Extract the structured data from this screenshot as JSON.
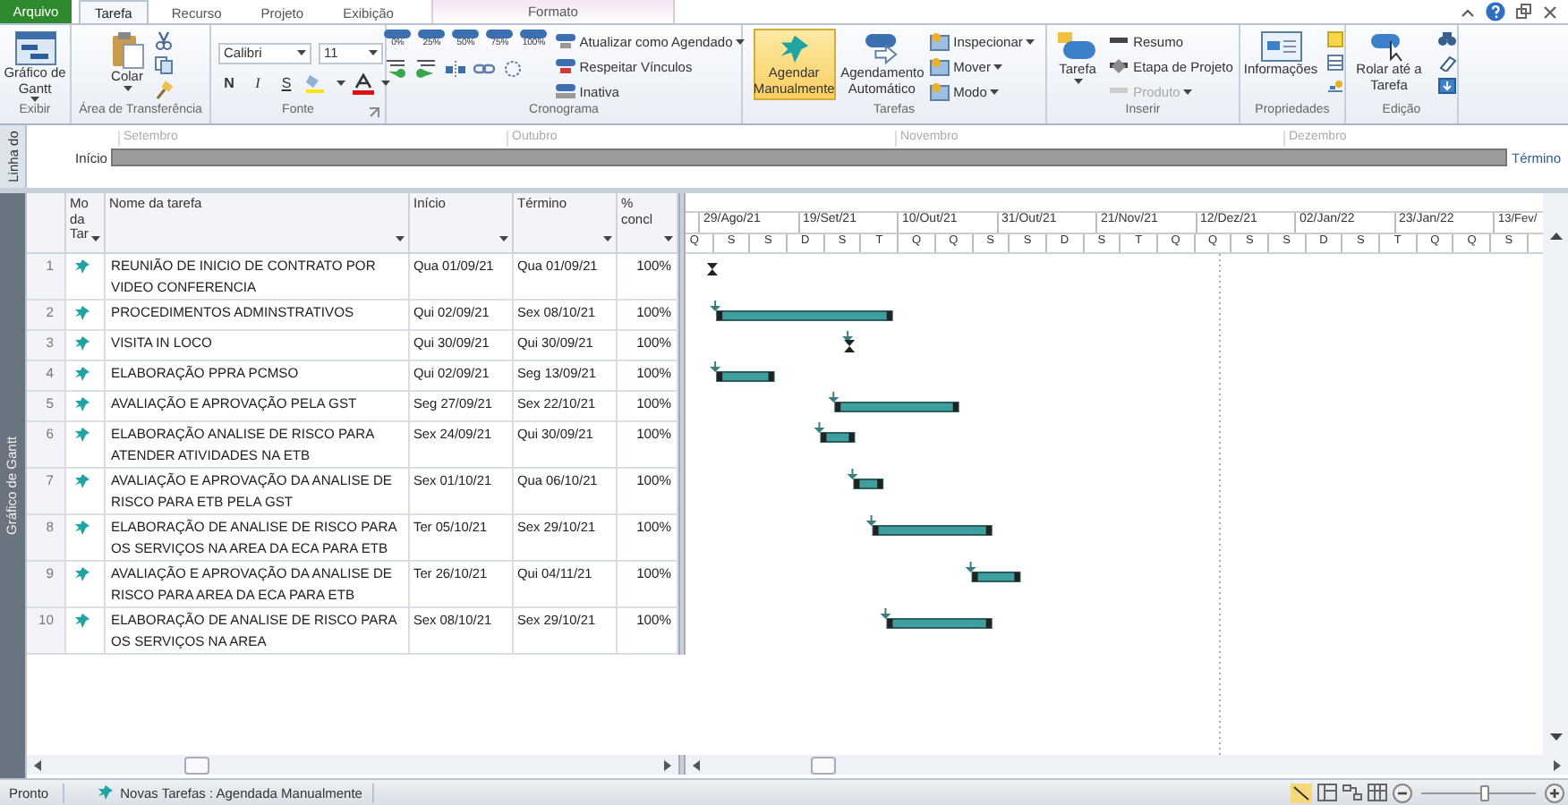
{
  "menu_tabs": [
    {
      "label": "Arquivo",
      "kind": "file",
      "selected": false
    },
    {
      "label": "Tarefa",
      "kind": "tab",
      "selected": true
    },
    {
      "label": "Recurso",
      "kind": "tab",
      "selected": false
    },
    {
      "label": "Projeto",
      "kind": "tab",
      "selected": false
    },
    {
      "label": "Exibição",
      "kind": "tab",
      "selected": false
    }
  ],
  "contextual_tab": {
    "label": "Formato"
  },
  "ribbon": {
    "view": {
      "label": "Exibir",
      "gantt_button": "Gráfico de Gantt"
    },
    "clipboard": {
      "label": "Área de Transferência",
      "paste_button": "Colar"
    },
    "font": {
      "label": "Fonte",
      "font_name": "Calibri",
      "font_size": "11",
      "bold": "N",
      "italic": "I",
      "underline": "S"
    },
    "schedule": {
      "label": "Cronograma",
      "percent_buttons": [
        "0%",
        "25%",
        "50%",
        "75%",
        "100%"
      ],
      "commands": [
        "Atualizar como Agendado",
        "Respeitar Vínculos",
        "Inativa"
      ]
    },
    "tasks": {
      "label": "Tarefas",
      "manual": {
        "label": "Agendar Manualmente",
        "selected": true
      },
      "auto": {
        "label": "Agendamento Automático",
        "selected": false
      },
      "commands": [
        "Inspecionar",
        "Mover",
        "Modo"
      ]
    },
    "insert": {
      "label": "Inserir",
      "task_button": "Tarefa",
      "commands": [
        {
          "label": "Resumo",
          "disabled": false
        },
        {
          "label": "Etapa de Projeto",
          "disabled": false
        },
        {
          "label": "Produto",
          "disabled": true
        }
      ]
    },
    "properties": {
      "label": "Propriedades",
      "info_button": "Informações"
    },
    "editing": {
      "label": "Edição",
      "scroll_button": "Rolar até a Tarefa"
    }
  },
  "timeline": {
    "side_label": "Linha do",
    "start_label": "Início",
    "end_label": "Término",
    "months": [
      "Setembro",
      "Outubro",
      "Novembro",
      "Dezembro"
    ]
  },
  "view_bar": {
    "label": "Gráfico de Gantt"
  },
  "table": {
    "columns": [
      "Mo da Tar",
      "Nome da tarefa",
      "Início",
      "Término",
      "% concl"
    ],
    "rows": [
      {
        "id": "1",
        "name": "REUNIÃO DE INICIO DE CONTRATO POR VIDEO CONFERENCIA",
        "start": "Qua 01/09/21",
        "finish": "Qua 01/09/21",
        "complete": "100%"
      },
      {
        "id": "2",
        "name": "PROCEDIMENTOS ADMINSTRATIVOS",
        "start": "Qui 02/09/21",
        "finish": "Sex 08/10/21",
        "complete": "100%"
      },
      {
        "id": "3",
        "name": "VISITA IN LOCO",
        "start": "Qui 30/09/21",
        "finish": "Qui 30/09/21",
        "complete": "100%"
      },
      {
        "id": "4",
        "name": "ELABORAÇÃO PPRA PCMSO",
        "start": "Qui 02/09/21",
        "finish": "Seg 13/09/21",
        "complete": "100%"
      },
      {
        "id": "5",
        "name": "AVALIAÇÃO E APROVAÇÃO PELA GST",
        "start": "Seg 27/09/21",
        "finish": "Sex 22/10/21",
        "complete": "100%"
      },
      {
        "id": "6",
        "name": "ELABORAÇÃO ANALISE DE RISCO PARA ATENDER ATIVIDADES NA ETB",
        "start": "Sex 24/09/21",
        "finish": "Qui 30/09/21",
        "complete": "100%"
      },
      {
        "id": "7",
        "name": "AVALIAÇÃO E APROVAÇÃO DA ANALISE DE RISCO PARA ETB PELA GST",
        "start": "Sex 01/10/21",
        "finish": "Qua 06/10/21",
        "complete": "100%"
      },
      {
        "id": "8",
        "name": "ELABORAÇÃO DE ANALISE DE RISCO PARA OS SERVIÇOS NA AREA DA ECA PARA ETB",
        "start": "Ter 05/10/21",
        "finish": "Sex 29/10/21",
        "complete": "100%"
      },
      {
        "id": "9",
        "name": "AVALIAÇÃO E APROVAÇÃO DA ANALISE DE RISCO PARA AREA DA ECA PARA ETB",
        "start": "Ter 26/10/21",
        "finish": "Qui 04/11/21",
        "complete": "100%"
      },
      {
        "id": "10",
        "name": "ELABORAÇÃO DE ANALISE DE RISCO PARA OS SERVIÇOS NA AREA",
        "start": "Sex 08/10/21",
        "finish": "Sex 29/10/21",
        "complete": "100%"
      }
    ]
  },
  "gantt": {
    "top_tier": [
      "29/Ago/21",
      "19/Set/21",
      "10/Out/21",
      "31/Out/21",
      "21/Nov/21",
      "12/Dez/21",
      "02/Jan/22",
      "23/Jan/22",
      "13/Fev/"
    ],
    "bottom_tier": [
      "Q",
      "S",
      "S",
      "D",
      "S",
      "T",
      "Q",
      "Q",
      "S",
      "S",
      "D",
      "S",
      "T",
      "Q",
      "Q",
      "S",
      "S",
      "D",
      "S",
      "T",
      "Q",
      "Q",
      "S"
    ]
  },
  "status_bar": {
    "status": "Pronto",
    "new_tasks": "Novas Tarefas : Agendada Manualmente",
    "zoom": {
      "level": 0.55
    }
  }
}
